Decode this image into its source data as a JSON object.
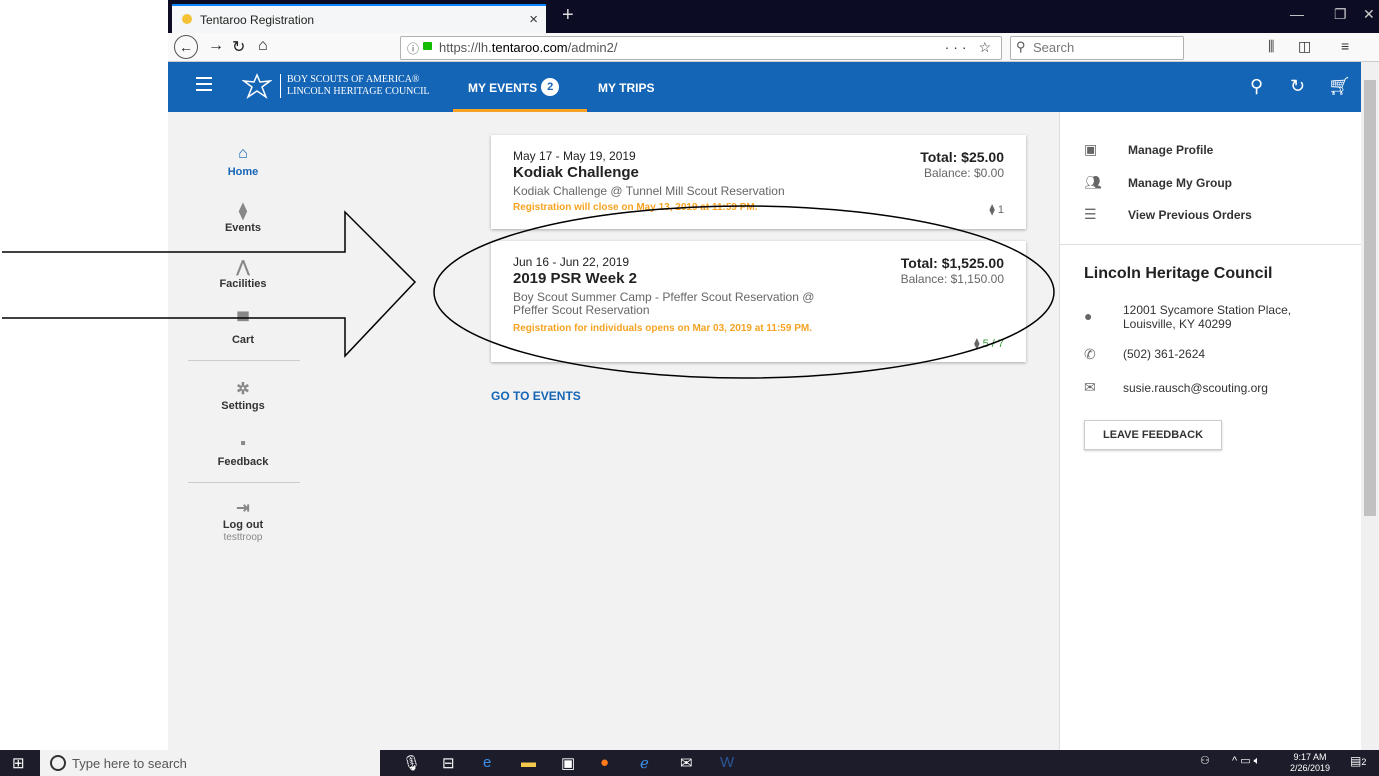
{
  "browser": {
    "tab_title": "Tentaroo Registration",
    "tab_close": "×",
    "new_tab": "+",
    "url_host": "https://lh.",
    "url_domain": "tentaroo.com",
    "url_path": "/admin2/",
    "url_actions": "··· ☆",
    "search_placeholder": "Search"
  },
  "header": {
    "org_line1": "BOY SCOUTS OF AMERICA®",
    "org_line2": "LINCOLN HERITAGE COUNCIL",
    "my_events": "MY EVENTS",
    "events_count": "2",
    "my_trips": "MY TRIPS",
    "accent": "#1565b6",
    "underline_color": "#f6a323"
  },
  "sidenav": {
    "home": "Home",
    "events": "Events",
    "facilities": "Facilities",
    "cart": "Cart",
    "settings": "Settings",
    "feedback": "Feedback",
    "logout": "Log out",
    "username": "testtroop"
  },
  "events": [
    {
      "date": "May 17 - May 19, 2019",
      "name": "Kodiak Challenge",
      "desc": "Kodiak Challenge @ Tunnel Mill Scout Reservation",
      "note": "Registration will close on May 13, 2019 at 11:59 PM.",
      "total": "Total: $25.00",
      "balance": "Balance: $0.00",
      "tickets": "1"
    },
    {
      "date": "Jun 16 - Jun 22, 2019",
      "name": "2019 PSR Week 2",
      "desc": "Boy Scout Summer Camp - Pfeffer Scout Reservation @ Pfeffer Scout Reservation",
      "note": "Registration for individuals opens on Mar 03, 2019 at 11:59 PM.",
      "total": "Total: $1,525.00",
      "balance": "Balance: $1,150.00",
      "tickets": "5 / 7"
    }
  ],
  "go_to_events": "GO TO EVENTS",
  "right_panel": {
    "manage_profile": "Manage Profile",
    "manage_group": "Manage My Group",
    "previous_orders": "View Previous Orders",
    "council": "Lincoln Heritage Council",
    "address1": "12001 Sycamore Station Place,",
    "address2": "Louisville, KY 40299",
    "phone": "(502) 361-2624",
    "email": "susie.rausch@scouting.org",
    "leave_feedback": "LEAVE FEEDBACK"
  },
  "taskbar": {
    "search_placeholder": "Type here to search",
    "time": "9:17 AM",
    "date": "2/26/2019",
    "notifications": "2"
  }
}
